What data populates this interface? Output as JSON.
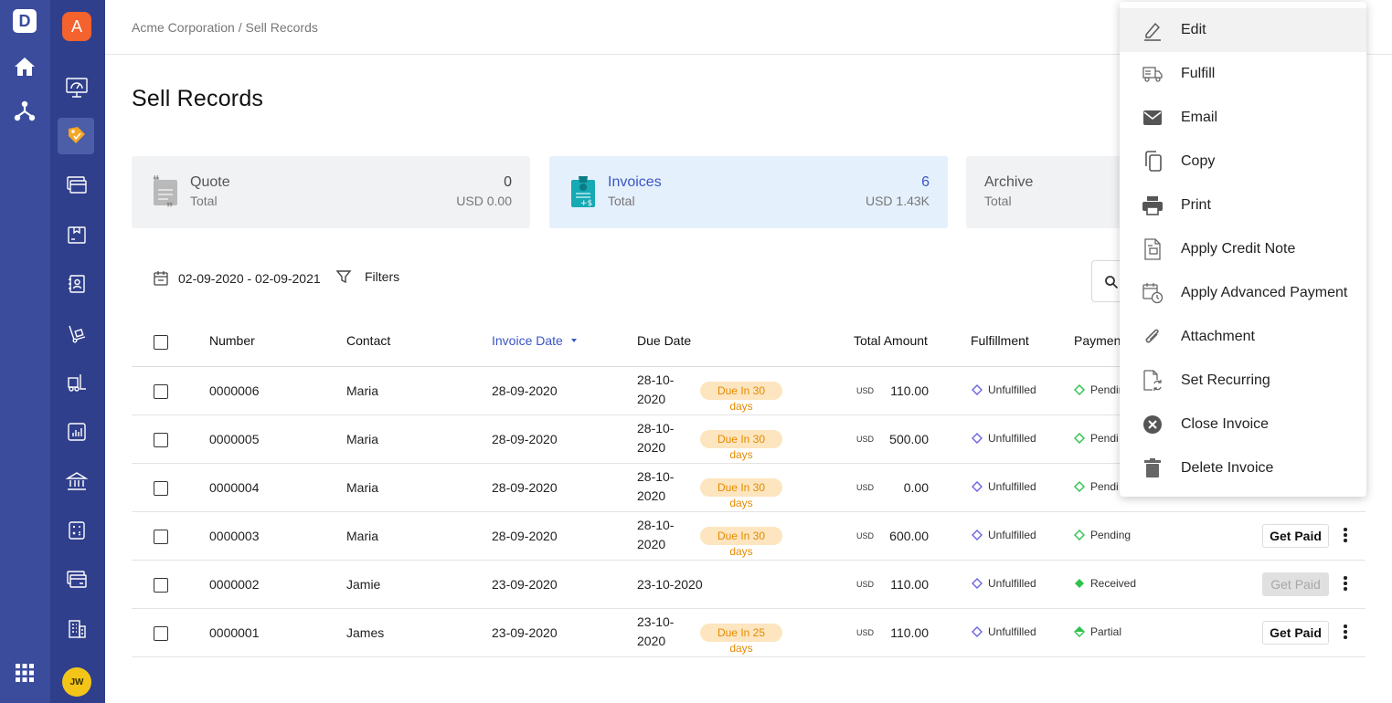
{
  "rail": {
    "logo_letter": "D",
    "org_letter": "A",
    "org_color": "#f4622d",
    "avatar_initials": "JW",
    "avatar_color": "#f3c518",
    "active_item": "sales-icon"
  },
  "breadcrumb": "Acme Corporation / Sell Records",
  "page_title": "Sell Records",
  "cards": [
    {
      "title": "Quote",
      "sub": "Total",
      "count": "0",
      "amount": "USD 0.00"
    },
    {
      "title": "Invoices",
      "sub": "Total",
      "count": "6",
      "amount": "USD 1.43K"
    },
    {
      "title": "Archive",
      "sub": "Total"
    }
  ],
  "filters": {
    "date_range": "02-09-2020 - 02-09-2021",
    "filters_label": "Filters"
  },
  "table": {
    "headers": {
      "number": "Number",
      "contact": "Contact",
      "invoice_date": "Invoice Date",
      "due_date": "Due Date",
      "total_amount": "Total Amount",
      "fulfillment": "Fulfillment",
      "payment": "Paymen"
    },
    "rows": [
      {
        "number": "0000006",
        "contact": "Maria",
        "invoice_date": "28-09-2020",
        "due_1": "28-10-",
        "due_2": "2020",
        "badge_1": "Due In 30",
        "badge_2": "days",
        "currency": "USD",
        "amount": "110.00",
        "fulfillment": "Unfulfilled",
        "payment": "Pendin"
      },
      {
        "number": "0000005",
        "contact": "Maria",
        "invoice_date": "28-09-2020",
        "due_1": "28-10-",
        "due_2": "2020",
        "badge_1": "Due In 30",
        "badge_2": "days",
        "currency": "USD",
        "amount": "500.00",
        "fulfillment": "Unfulfilled",
        "payment": "Pendi"
      },
      {
        "number": "0000004",
        "contact": "Maria",
        "invoice_date": "28-09-2020",
        "due_1": "28-10-",
        "due_2": "2020",
        "badge_1": "Due In 30",
        "badge_2": "days",
        "currency": "USD",
        "amount": "0.00",
        "fulfillment": "Unfulfilled",
        "payment": "Pendi"
      },
      {
        "number": "0000003",
        "contact": "Maria",
        "invoice_date": "28-09-2020",
        "due_1": "28-10-",
        "due_2": "2020",
        "badge_1": "Due In 30",
        "badge_2": "days",
        "currency": "USD",
        "amount": "600.00",
        "fulfillment": "Unfulfilled",
        "payment": "Pending",
        "action": "Get Paid"
      },
      {
        "number": "0000002",
        "contact": "Jamie",
        "invoice_date": "23-09-2020",
        "due_single": "23-10-2020",
        "currency": "USD",
        "amount": "110.00",
        "fulfillment": "Unfulfilled",
        "payment": "Received",
        "action": "Get Paid"
      },
      {
        "number": "0000001",
        "contact": "James",
        "invoice_date": "23-09-2020",
        "due_1": "23-10-",
        "due_2": "2020",
        "badge_1": "Due In 25",
        "badge_2": "days",
        "currency": "USD",
        "amount": "110.00",
        "fulfillment": "Unfulfilled",
        "payment": "Partial",
        "action": "Get Paid"
      }
    ]
  },
  "menu": {
    "items": [
      {
        "label": "Edit",
        "icon": "pencil-icon"
      },
      {
        "label": "Fulfill",
        "icon": "truck-icon"
      },
      {
        "label": "Email",
        "icon": "envelope-icon"
      },
      {
        "label": "Copy",
        "icon": "copy-icon"
      },
      {
        "label": "Print",
        "icon": "printer-icon"
      },
      {
        "label": "Apply Credit Note",
        "icon": "credit-note-icon"
      },
      {
        "label": "Apply Advanced Payment",
        "icon": "calendar-clock-icon"
      },
      {
        "label": "Attachment",
        "icon": "paperclip-icon"
      },
      {
        "label": "Set Recurring",
        "icon": "recurring-doc-icon"
      },
      {
        "label": "Close Invoice",
        "icon": "close-circle-icon"
      },
      {
        "label": "Delete Invoice",
        "icon": "trash-icon"
      }
    ]
  },
  "colors": {
    "accent": "#3b56c5",
    "badge_bg": "#fde5bf",
    "badge_text": "#e58a00",
    "pending": "#2ec24c",
    "unfulfilled": "#6b63e6"
  }
}
